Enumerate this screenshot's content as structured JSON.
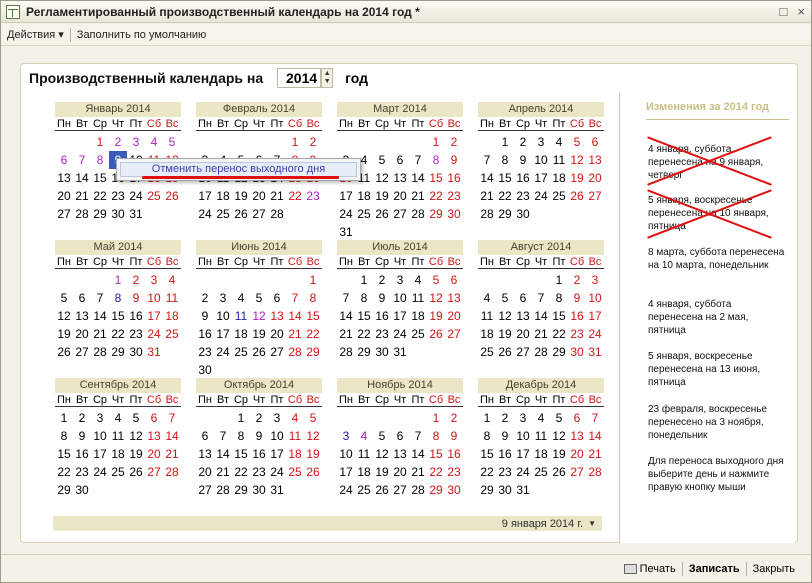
{
  "window": {
    "title": "Регламентированный производственный календарь на 2014 год *",
    "buttons": [
      "□",
      "×"
    ]
  },
  "toolbar": {
    "actions": "Действия",
    "fill_default": "Заполнить по умолчанию"
  },
  "header": {
    "label": "Производственный календарь на",
    "year": "2014",
    "suffix": "год"
  },
  "weekdays": [
    "Пн",
    "Вт",
    "Ср",
    "Чт",
    "Пт",
    "Сб",
    "Вс"
  ],
  "context_menu": {
    "item": "Отменить перенос выходного дня"
  },
  "months": [
    {
      "name": "Январь 2014",
      "offset": 2,
      "days": 31,
      "weekend": [
        1,
        2,
        3,
        4,
        5,
        6,
        7,
        8,
        11,
        12,
        18,
        19,
        25,
        26
      ],
      "transfer": [
        2,
        3,
        4,
        5,
        6,
        7,
        8
      ],
      "selected": 9
    },
    {
      "name": "Февраль 2014",
      "offset": 5,
      "days": 28,
      "weekend": [
        1,
        2,
        8,
        9,
        15,
        16,
        22,
        23
      ],
      "transfer": [
        23
      ]
    },
    {
      "name": "Март 2014",
      "offset": 5,
      "days": 31,
      "weekend": [
        1,
        2,
        8,
        9,
        10,
        15,
        16,
        22,
        23,
        29,
        30
      ],
      "transfer": [
        8
      ]
    },
    {
      "name": "Апрель 2014",
      "offset": 1,
      "days": 30,
      "weekend": [
        5,
        6,
        12,
        13,
        19,
        20,
        26,
        27
      ]
    },
    {
      "name": "Май 2014",
      "offset": 3,
      "days": 31,
      "weekend": [
        1,
        2,
        3,
        4,
        9,
        10,
        11,
        17,
        18,
        24,
        25,
        31
      ],
      "transfer": [
        1
      ],
      "holiday": [
        8
      ]
    },
    {
      "name": "Июнь 2014",
      "offset": 6,
      "days": 30,
      "weekend": [
        1,
        7,
        8,
        12,
        13,
        14,
        15,
        21,
        22,
        28,
        29
      ],
      "transfer": [
        12
      ],
      "holiday": [
        11
      ]
    },
    {
      "name": "Июль 2014",
      "offset": 1,
      "days": 31,
      "weekend": [
        5,
        6,
        12,
        13,
        19,
        20,
        26,
        27
      ]
    },
    {
      "name": "Август 2014",
      "offset": 4,
      "days": 31,
      "weekend": [
        2,
        3,
        9,
        10,
        16,
        17,
        23,
        24,
        30,
        31
      ]
    },
    {
      "name": "Сентябрь 2014",
      "offset": 0,
      "days": 30,
      "weekend": [
        6,
        7,
        13,
        14,
        20,
        21,
        27,
        28
      ]
    },
    {
      "name": "Октябрь 2014",
      "offset": 2,
      "days": 31,
      "weekend": [
        4,
        5,
        11,
        12,
        18,
        19,
        25,
        26
      ]
    },
    {
      "name": "Ноябрь 2014",
      "offset": 5,
      "days": 30,
      "weekend": [
        1,
        2,
        4,
        8,
        9,
        15,
        16,
        22,
        23,
        29,
        30
      ],
      "transfer": [
        4
      ],
      "holiday": [
        3
      ]
    },
    {
      "name": "Декабрь 2014",
      "offset": 0,
      "days": 31,
      "weekend": [
        6,
        7,
        13,
        14,
        20,
        21,
        27,
        28
      ]
    }
  ],
  "changes": {
    "title": "Изменения за 2014 год",
    "notes": [
      "4 января, суббота перенесена на 9 января, четверг",
      "5 января, воскресенье перенесена на 10 января, пятница",
      "8 марта, суббота перенесена на 10 марта, понедельник",
      "4 января, суббота перенесена на 2 мая, пятница",
      "5 января, воскресенье перенесена на 13 июня, пятница",
      "23 февраля, воскресенье перенесено на 3 ноября, понедельник",
      "Для переноса выходного дня выберите день и нажмите правую кнопку мыши"
    ]
  },
  "status": {
    "date": "9 января 2014 г.",
    "arrow": "▼"
  },
  "footer": {
    "print": "Печать",
    "save": "Записать",
    "close": "Закрыть"
  },
  "colors": {
    "weekend": "#d21414",
    "transfer": "#b020c0",
    "selected": "#3b5bb8",
    "header_bg": "#ebe6c6"
  }
}
